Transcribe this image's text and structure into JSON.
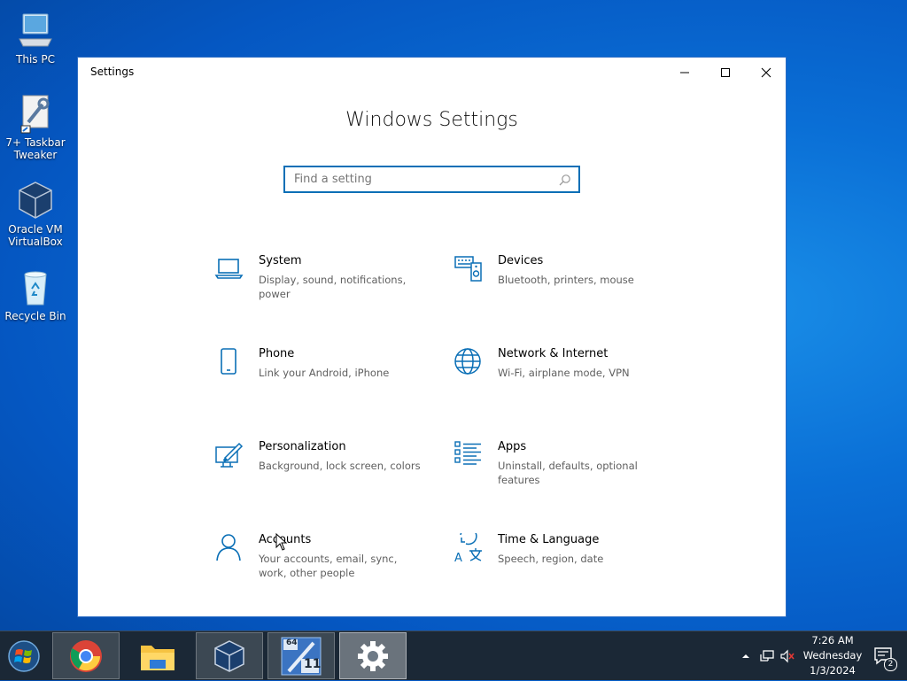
{
  "desktop": {
    "icons": [
      {
        "label": "This PC"
      },
      {
        "label": "7+ Taskbar Tweaker"
      },
      {
        "label": "Oracle VM VirtualBox"
      },
      {
        "label": "Recycle Bin"
      }
    ]
  },
  "window": {
    "title": "Settings",
    "heading": "Windows Settings",
    "search": {
      "placeholder": "Find a setting",
      "value": ""
    },
    "tiles": [
      {
        "name": "System",
        "desc": "Display, sound, notifications, power",
        "icon": "laptop-icon"
      },
      {
        "name": "Devices",
        "desc": "Bluetooth, printers, mouse",
        "icon": "devices-icon"
      },
      {
        "name": "Phone",
        "desc": "Link your Android, iPhone",
        "icon": "phone-icon"
      },
      {
        "name": "Network & Internet",
        "desc": "Wi-Fi, airplane mode, VPN",
        "icon": "globe-icon"
      },
      {
        "name": "Personalization",
        "desc": "Background, lock screen, colors",
        "icon": "personalization-icon"
      },
      {
        "name": "Apps",
        "desc": "Uninstall, defaults, optional features",
        "icon": "apps-list-icon"
      },
      {
        "name": "Accounts",
        "desc": "Your accounts, email, sync, work, other people",
        "icon": "person-icon"
      },
      {
        "name": "Time & Language",
        "desc": "Speech, region, date",
        "icon": "time-language-icon"
      }
    ]
  },
  "taskbar": {
    "apps": [
      {
        "name": "chrome-icon"
      },
      {
        "name": "file-explorer-icon"
      },
      {
        "name": "virtualbox-icon"
      },
      {
        "name": "taskbar-tweaker-icon",
        "badge_top": "64",
        "badge_bottom": "11"
      },
      {
        "name": "settings-gear-icon"
      }
    ],
    "clock": {
      "time": "7:26 AM",
      "day": "Wednesday",
      "date": "1/3/2024"
    },
    "notifications_count": "2"
  },
  "colors": {
    "accent": "#0a6fb6",
    "taskbar": "#1b2836"
  }
}
